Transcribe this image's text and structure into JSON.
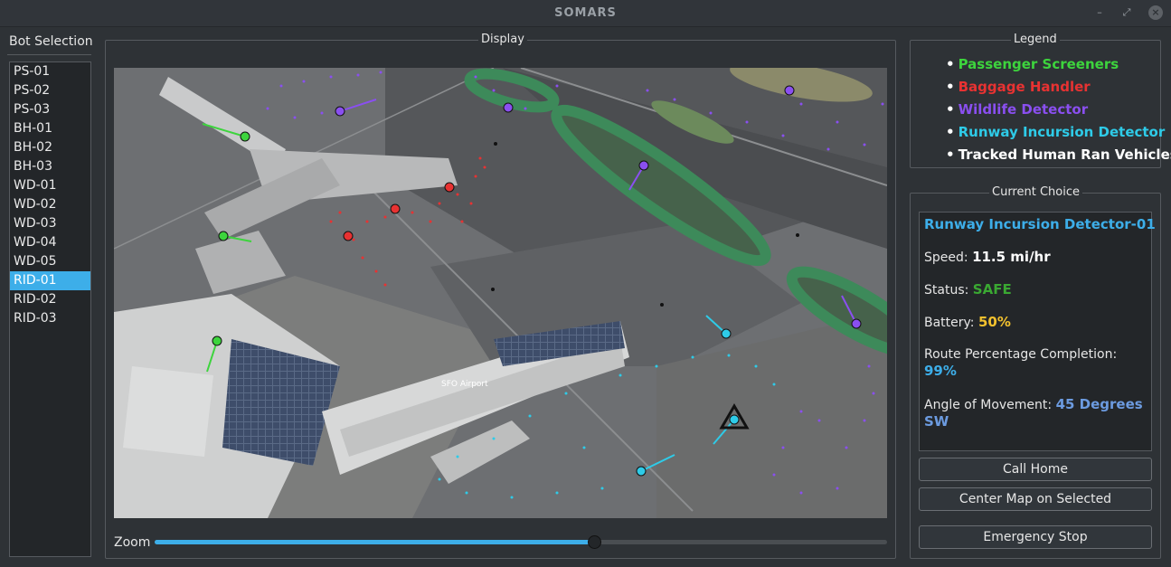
{
  "window": {
    "title": "SOMARS",
    "minimize": "–",
    "restore": "⤢",
    "close": "×"
  },
  "bot_selection": {
    "title": "Bot Selection",
    "items": [
      "PS-01",
      "PS-02",
      "PS-03",
      "BH-01",
      "BH-02",
      "BH-03",
      "WD-01",
      "WD-02",
      "WD-03",
      "WD-04",
      "WD-05",
      "RID-01",
      "RID-02",
      "RID-03"
    ],
    "selected": "RID-01"
  },
  "display": {
    "title": "Display",
    "map_label": "SFO Airport",
    "zoom_label": "Zoom",
    "zoom_value": 0.6
  },
  "legend": {
    "title": "Legend",
    "items": [
      {
        "label": "Passenger Screeners",
        "color": "#3dd43d"
      },
      {
        "label": "Baggage Handler",
        "color": "#e83232"
      },
      {
        "label": "Wildlife Detector",
        "color": "#8a4ff0"
      },
      {
        "label": "Runway Incursion Detector",
        "color": "#2ecbe8"
      },
      {
        "label": "Tracked Human Ran Vehicles",
        "color": "#ffffff"
      }
    ]
  },
  "current_choice": {
    "title": "Current Choice",
    "name": "Runway Incursion Detector-01",
    "speed_label": "Speed:",
    "speed_value": "11.5 mi/hr",
    "status_label": "Status:",
    "status_value": "SAFE",
    "battery_label": "Battery:",
    "battery_value": "50%",
    "route_label": "Route Percentage Completion:",
    "route_value": "99%",
    "angle_label": "Angle of Movement:",
    "angle_value": "45 Degrees SW"
  },
  "colors": {
    "accent": "#3daee9",
    "safe": "#3aa832",
    "battery": "#f2c12e",
    "route": "#3daee9",
    "angle": "#6c9be0"
  },
  "buttons": {
    "call_home": "Call Home",
    "center_map": "Center Map on Selected",
    "emergency_stop": "Emergency Stop"
  }
}
